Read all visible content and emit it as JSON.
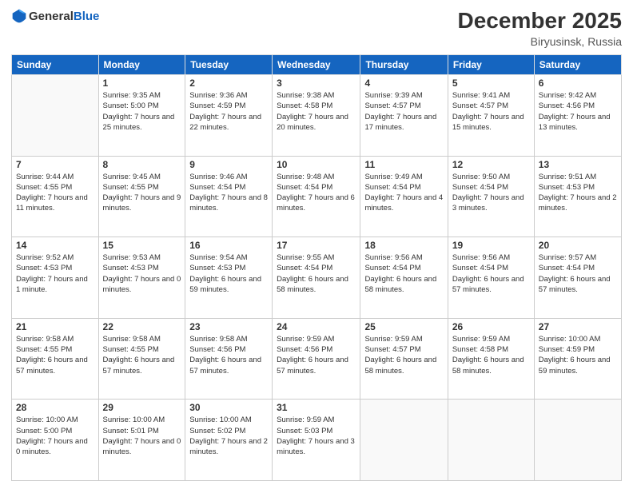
{
  "header": {
    "logo_general": "General",
    "logo_blue": "Blue",
    "month": "December 2025",
    "location": "Biryusinsk, Russia"
  },
  "weekdays": [
    "Sunday",
    "Monday",
    "Tuesday",
    "Wednesday",
    "Thursday",
    "Friday",
    "Saturday"
  ],
  "weeks": [
    [
      {
        "day": "",
        "sunrise": "",
        "sunset": "",
        "daylight": ""
      },
      {
        "day": "1",
        "sunrise": "Sunrise: 9:35 AM",
        "sunset": "Sunset: 5:00 PM",
        "daylight": "Daylight: 7 hours and 25 minutes."
      },
      {
        "day": "2",
        "sunrise": "Sunrise: 9:36 AM",
        "sunset": "Sunset: 4:59 PM",
        "daylight": "Daylight: 7 hours and 22 minutes."
      },
      {
        "day": "3",
        "sunrise": "Sunrise: 9:38 AM",
        "sunset": "Sunset: 4:58 PM",
        "daylight": "Daylight: 7 hours and 20 minutes."
      },
      {
        "day": "4",
        "sunrise": "Sunrise: 9:39 AM",
        "sunset": "Sunset: 4:57 PM",
        "daylight": "Daylight: 7 hours and 17 minutes."
      },
      {
        "day": "5",
        "sunrise": "Sunrise: 9:41 AM",
        "sunset": "Sunset: 4:57 PM",
        "daylight": "Daylight: 7 hours and 15 minutes."
      },
      {
        "day": "6",
        "sunrise": "Sunrise: 9:42 AM",
        "sunset": "Sunset: 4:56 PM",
        "daylight": "Daylight: 7 hours and 13 minutes."
      }
    ],
    [
      {
        "day": "7",
        "sunrise": "Sunrise: 9:44 AM",
        "sunset": "Sunset: 4:55 PM",
        "daylight": "Daylight: 7 hours and 11 minutes."
      },
      {
        "day": "8",
        "sunrise": "Sunrise: 9:45 AM",
        "sunset": "Sunset: 4:55 PM",
        "daylight": "Daylight: 7 hours and 9 minutes."
      },
      {
        "day": "9",
        "sunrise": "Sunrise: 9:46 AM",
        "sunset": "Sunset: 4:54 PM",
        "daylight": "Daylight: 7 hours and 8 minutes."
      },
      {
        "day": "10",
        "sunrise": "Sunrise: 9:48 AM",
        "sunset": "Sunset: 4:54 PM",
        "daylight": "Daylight: 7 hours and 6 minutes."
      },
      {
        "day": "11",
        "sunrise": "Sunrise: 9:49 AM",
        "sunset": "Sunset: 4:54 PM",
        "daylight": "Daylight: 7 hours and 4 minutes."
      },
      {
        "day": "12",
        "sunrise": "Sunrise: 9:50 AM",
        "sunset": "Sunset: 4:54 PM",
        "daylight": "Daylight: 7 hours and 3 minutes."
      },
      {
        "day": "13",
        "sunrise": "Sunrise: 9:51 AM",
        "sunset": "Sunset: 4:53 PM",
        "daylight": "Daylight: 7 hours and 2 minutes."
      }
    ],
    [
      {
        "day": "14",
        "sunrise": "Sunrise: 9:52 AM",
        "sunset": "Sunset: 4:53 PM",
        "daylight": "Daylight: 7 hours and 1 minute."
      },
      {
        "day": "15",
        "sunrise": "Sunrise: 9:53 AM",
        "sunset": "Sunset: 4:53 PM",
        "daylight": "Daylight: 7 hours and 0 minutes."
      },
      {
        "day": "16",
        "sunrise": "Sunrise: 9:54 AM",
        "sunset": "Sunset: 4:53 PM",
        "daylight": "Daylight: 6 hours and 59 minutes."
      },
      {
        "day": "17",
        "sunrise": "Sunrise: 9:55 AM",
        "sunset": "Sunset: 4:54 PM",
        "daylight": "Daylight: 6 hours and 58 minutes."
      },
      {
        "day": "18",
        "sunrise": "Sunrise: 9:56 AM",
        "sunset": "Sunset: 4:54 PM",
        "daylight": "Daylight: 6 hours and 58 minutes."
      },
      {
        "day": "19",
        "sunrise": "Sunrise: 9:56 AM",
        "sunset": "Sunset: 4:54 PM",
        "daylight": "Daylight: 6 hours and 57 minutes."
      },
      {
        "day": "20",
        "sunrise": "Sunrise: 9:57 AM",
        "sunset": "Sunset: 4:54 PM",
        "daylight": "Daylight: 6 hours and 57 minutes."
      }
    ],
    [
      {
        "day": "21",
        "sunrise": "Sunrise: 9:58 AM",
        "sunset": "Sunset: 4:55 PM",
        "daylight": "Daylight: 6 hours and 57 minutes."
      },
      {
        "day": "22",
        "sunrise": "Sunrise: 9:58 AM",
        "sunset": "Sunset: 4:55 PM",
        "daylight": "Daylight: 6 hours and 57 minutes."
      },
      {
        "day": "23",
        "sunrise": "Sunrise: 9:58 AM",
        "sunset": "Sunset: 4:56 PM",
        "daylight": "Daylight: 6 hours and 57 minutes."
      },
      {
        "day": "24",
        "sunrise": "Sunrise: 9:59 AM",
        "sunset": "Sunset: 4:56 PM",
        "daylight": "Daylight: 6 hours and 57 minutes."
      },
      {
        "day": "25",
        "sunrise": "Sunrise: 9:59 AM",
        "sunset": "Sunset: 4:57 PM",
        "daylight": "Daylight: 6 hours and 58 minutes."
      },
      {
        "day": "26",
        "sunrise": "Sunrise: 9:59 AM",
        "sunset": "Sunset: 4:58 PM",
        "daylight": "Daylight: 6 hours and 58 minutes."
      },
      {
        "day": "27",
        "sunrise": "Sunrise: 10:00 AM",
        "sunset": "Sunset: 4:59 PM",
        "daylight": "Daylight: 6 hours and 59 minutes."
      }
    ],
    [
      {
        "day": "28",
        "sunrise": "Sunrise: 10:00 AM",
        "sunset": "Sunset: 5:00 PM",
        "daylight": "Daylight: 7 hours and 0 minutes."
      },
      {
        "day": "29",
        "sunrise": "Sunrise: 10:00 AM",
        "sunset": "Sunset: 5:01 PM",
        "daylight": "Daylight: 7 hours and 0 minutes."
      },
      {
        "day": "30",
        "sunrise": "Sunrise: 10:00 AM",
        "sunset": "Sunset: 5:02 PM",
        "daylight": "Daylight: 7 hours and 2 minutes."
      },
      {
        "day": "31",
        "sunrise": "Sunrise: 9:59 AM",
        "sunset": "Sunset: 5:03 PM",
        "daylight": "Daylight: 7 hours and 3 minutes."
      },
      {
        "day": "",
        "sunrise": "",
        "sunset": "",
        "daylight": ""
      },
      {
        "day": "",
        "sunrise": "",
        "sunset": "",
        "daylight": ""
      },
      {
        "day": "",
        "sunrise": "",
        "sunset": "",
        "daylight": ""
      }
    ]
  ]
}
